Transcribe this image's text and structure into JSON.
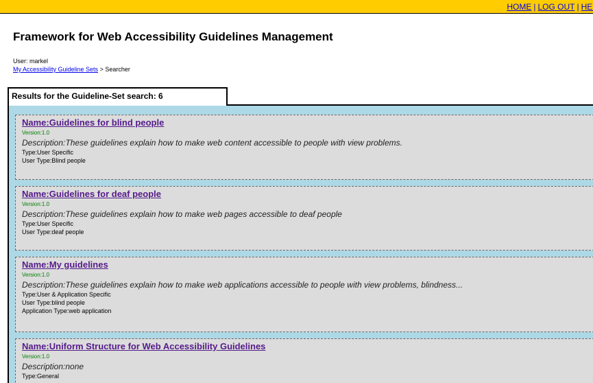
{
  "topnav": {
    "home": "HOME",
    "logout": "LOG OUT",
    "help": "HELP",
    "separator": "|"
  },
  "page": {
    "title": "Framework for Web Accessibility Guidelines Management",
    "user_line": "User: markel",
    "breadcrumb": {
      "link": "My Accessibility Guideline Sets",
      "separator": ">",
      "current": "Searcher"
    }
  },
  "results": {
    "heading": "Results for the Guideline-Set search: 6",
    "items": [
      {
        "name": "Name:Guidelines for blind people",
        "version": "Version:1.0",
        "description": "Description:These guidelines explain how to make web content accessible to people with view problems.",
        "meta": [
          "Type:User Specific",
          "User Type:Blind people"
        ]
      },
      {
        "name": "Name:Guidelines for deaf people",
        "version": "Version:1.0",
        "description": "Description:These guidelines explain how to make web pages accessible to deaf people",
        "meta": [
          "Type:User Specific",
          "User Type:deaf people"
        ]
      },
      {
        "name": "Name:My guidelines",
        "version": "Version:1.0",
        "description": "Description:These guidelines explain how to make web applications accessible to people with view problems, blindness...",
        "meta": [
          "Type:User & Application Specific",
          "User Type:blind people",
          "Application Type:web application"
        ]
      },
      {
        "name": "Name:Uniform Structure for Web Accessibility Guidelines",
        "version": "Version:1.0",
        "description": "Description:none",
        "meta": [
          "Type:General"
        ]
      }
    ]
  },
  "colors": {
    "topbar": "#FFCC00",
    "panel": "#add8e6",
    "card": "#dcdcdc",
    "visited_link": "#551a8b",
    "link": "#0000ee",
    "version": "#008000"
  }
}
